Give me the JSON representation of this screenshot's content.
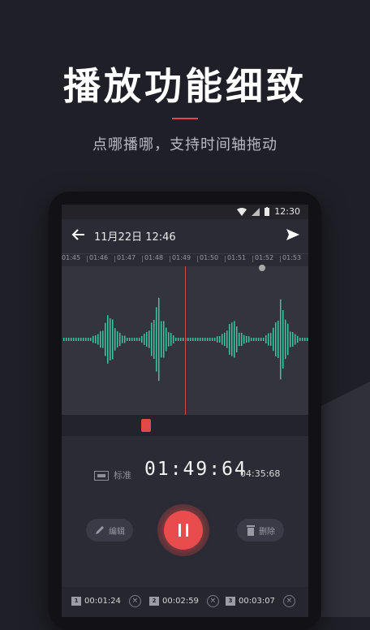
{
  "hero": {
    "title": "播放功能细致",
    "subtitle": "点哪播哪，支持时间轴拖动"
  },
  "status_bar": {
    "time": "12:30"
  },
  "app_bar": {
    "date_time": "11月22日  12:46"
  },
  "timeline": {
    "ticks": [
      "01:45",
      "01:46",
      "01:47",
      "01:48",
      "01:49",
      "01:50",
      "01:51",
      "01:52",
      "01:53"
    ]
  },
  "player": {
    "quality_label": "标准",
    "current_time": "01:49:64",
    "total_time": "04:35:68",
    "edit_label": "编辑",
    "delete_label": "删除"
  },
  "marks": [
    {
      "index": "1",
      "time": "00:01:24"
    },
    {
      "index": "2",
      "time": "00:02:59"
    },
    {
      "index": "3",
      "time": "00:03:07"
    }
  ],
  "colors": {
    "accent": "#e84c4c",
    "wave": "#3fc4a2",
    "background": "#1f1f27"
  }
}
